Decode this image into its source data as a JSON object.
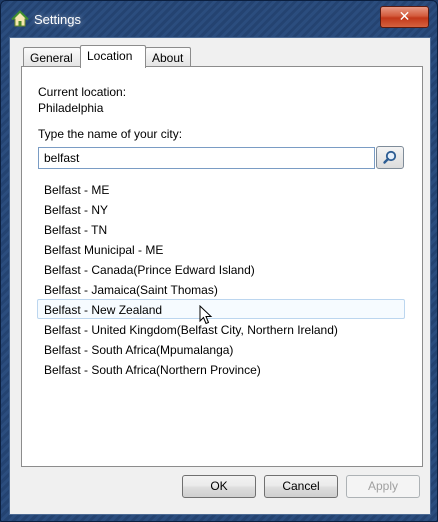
{
  "window": {
    "title": "Settings"
  },
  "tabs": [
    {
      "label": "General"
    },
    {
      "label": "Location"
    },
    {
      "label": "About"
    }
  ],
  "location": {
    "current_label": "Current location:",
    "current_value": "Philadelphia",
    "prompt": "Type the name of your city:",
    "search_value": "belfast",
    "results": [
      "Belfast - ME",
      "Belfast - NY",
      "Belfast - TN",
      "Belfast Municipal - ME",
      "Belfast - Canada(Prince Edward Island)",
      "Belfast - Jamaica(Saint Thomas)",
      "Belfast - New Zealand",
      "Belfast - United Kingdom(Belfast City, Northern Ireland)",
      "Belfast - South Africa(Mpumalanga)",
      "Belfast - South Africa(Northern Province)"
    ],
    "hovered_index": 6
  },
  "buttons": {
    "ok": "OK",
    "cancel": "Cancel",
    "apply": "Apply"
  },
  "icons": {
    "app": "house-icon",
    "search": "magnifier-icon",
    "close": "close-icon"
  },
  "colors": {
    "titlebar": "#244371",
    "close": "#c2381a",
    "hover_border": "#bcd6ef"
  }
}
